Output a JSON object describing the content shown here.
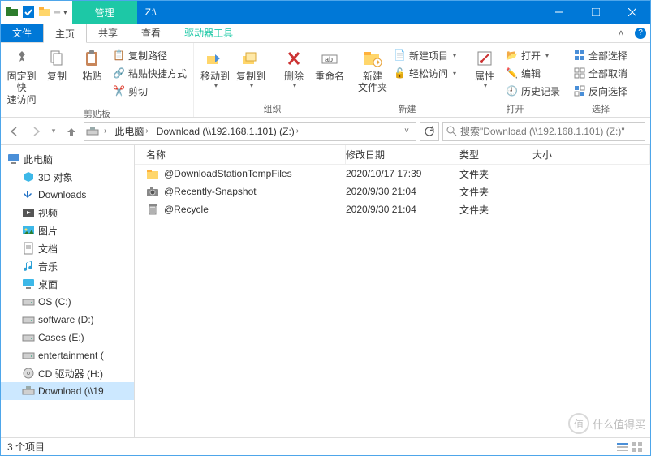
{
  "title": "Z:\\",
  "quick_access_toolbar": {
    "manage_label": "管理"
  },
  "tabs": {
    "file": "文件",
    "home": "主页",
    "share": "共享",
    "view": "查看",
    "drive_tools": "驱动器工具"
  },
  "ribbon": {
    "clipboard": {
      "label": "剪贴板",
      "pin": "固定到快\n速访问",
      "copy": "复制",
      "paste": "粘贴",
      "copy_path": "复制路径",
      "paste_shortcut": "粘贴快捷方式",
      "cut": "剪切"
    },
    "organize": {
      "label": "组织",
      "move_to": "移动到",
      "copy_to": "复制到",
      "delete": "删除",
      "rename": "重命名"
    },
    "new": {
      "label": "新建",
      "new_folder": "新建\n文件夹",
      "new_item": "新建项目",
      "easy_access": "轻松访问"
    },
    "open": {
      "label": "打开",
      "properties": "属性",
      "open": "打开",
      "edit": "编辑",
      "history": "历史记录"
    },
    "select": {
      "label": "选择",
      "select_all": "全部选择",
      "select_none": "全部取消",
      "invert": "反向选择"
    }
  },
  "breadcrumb": {
    "this_pc": "此电脑",
    "path": "Download (\\\\192.168.1.101) (Z:)"
  },
  "search_placeholder": "搜索\"Download (\\\\192.168.1.101) (Z:)\"",
  "columns": {
    "name": "名称",
    "date": "修改日期",
    "type": "类型",
    "size": "大小"
  },
  "sidebar": {
    "this_pc": "此电脑",
    "items": [
      {
        "label": "3D 对象",
        "icon": "3d"
      },
      {
        "label": "Downloads",
        "icon": "downloads"
      },
      {
        "label": "视频",
        "icon": "videos"
      },
      {
        "label": "图片",
        "icon": "pictures"
      },
      {
        "label": "文档",
        "icon": "documents"
      },
      {
        "label": "音乐",
        "icon": "music"
      },
      {
        "label": "桌面",
        "icon": "desktop"
      },
      {
        "label": "OS (C:)",
        "icon": "drive"
      },
      {
        "label": "software (D:)",
        "icon": "drive"
      },
      {
        "label": "Cases (E:)",
        "icon": "drive"
      },
      {
        "label": "entertainment (",
        "icon": "drive"
      },
      {
        "label": "CD 驱动器 (H:)",
        "icon": "cd"
      },
      {
        "label": "Download (\\\\19",
        "icon": "netdrive",
        "selected": true
      }
    ]
  },
  "files": [
    {
      "name": "@DownloadStationTempFiles",
      "date": "2020/10/17 17:39",
      "type": "文件夹",
      "icon": "folder"
    },
    {
      "name": "@Recently-Snapshot",
      "date": "2020/9/30 21:04",
      "type": "文件夹",
      "icon": "camera"
    },
    {
      "name": "@Recycle",
      "date": "2020/9/30 21:04",
      "type": "文件夹",
      "icon": "recycle"
    }
  ],
  "status": "3 个项目",
  "watermark": "什么值得买"
}
